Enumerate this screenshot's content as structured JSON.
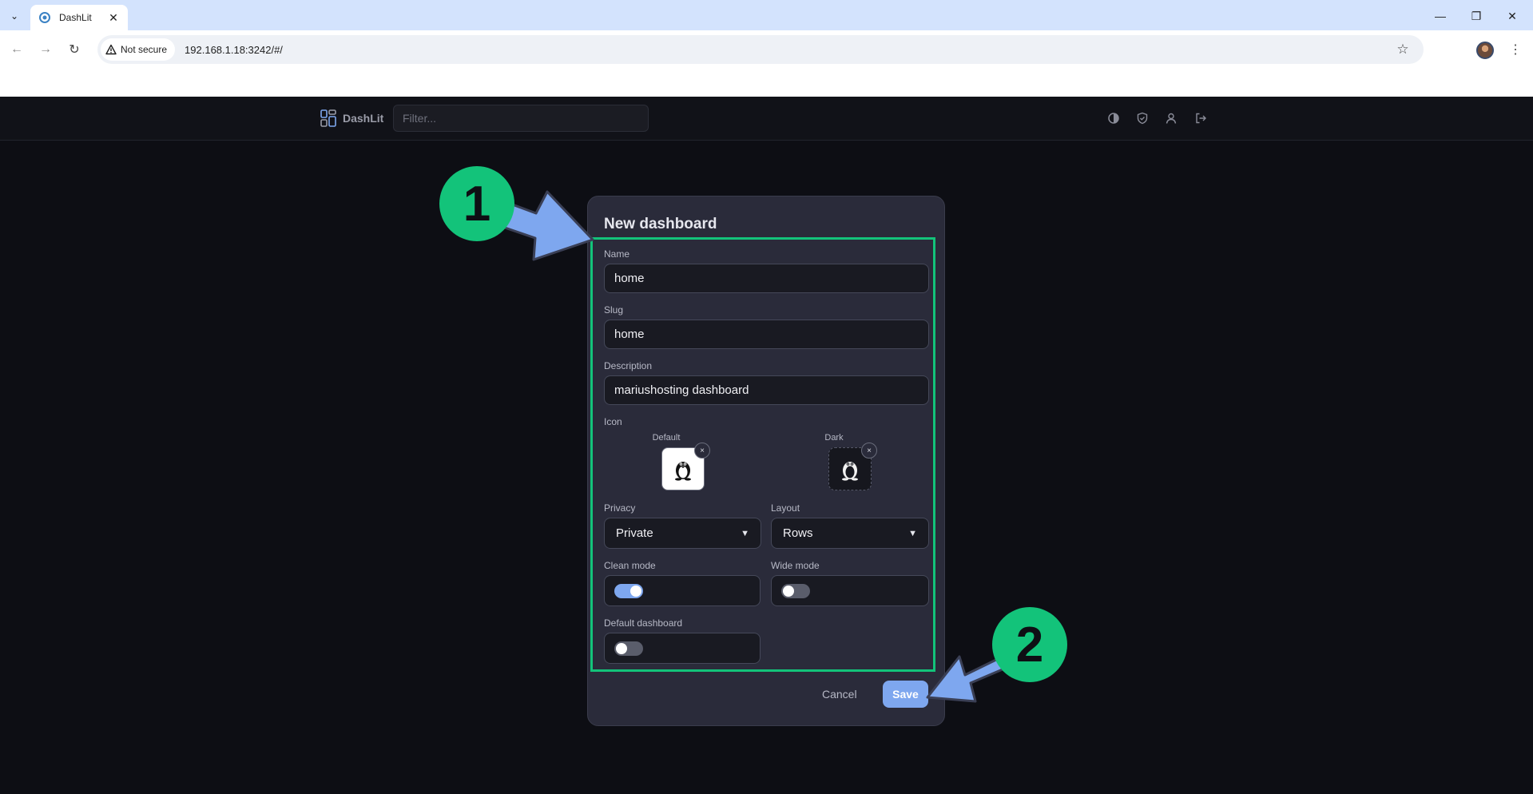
{
  "browser": {
    "tab_title": "DashLit",
    "security_label": "Not secure",
    "url": "192.168.1.18:3242/#/"
  },
  "app": {
    "brand_name": "DashLit",
    "filter_placeholder": "Filter..."
  },
  "modal": {
    "title": "New dashboard",
    "name_label": "Name",
    "name_value": "home",
    "slug_label": "Slug",
    "slug_value": "home",
    "description_label": "Description",
    "description_value": "mariushosting dashboard",
    "icon_label": "Icon",
    "icon_default_caption": "Default",
    "icon_dark_caption": "Dark",
    "remove_glyph": "×",
    "privacy_label": "Privacy",
    "privacy_value": "Private",
    "layout_label": "Layout",
    "layout_value": "Rows",
    "clean_mode_label": "Clean mode",
    "clean_mode_on": true,
    "wide_mode_label": "Wide mode",
    "wide_mode_on": false,
    "default_dashboard_label": "Default dashboard",
    "default_dashboard_on": false,
    "cancel_label": "Cancel",
    "save_label": "Save"
  },
  "annotations": {
    "step1": "1",
    "step2": "2",
    "highlight_color": "#13c37a",
    "arrow_color": "#7ea7ef"
  }
}
